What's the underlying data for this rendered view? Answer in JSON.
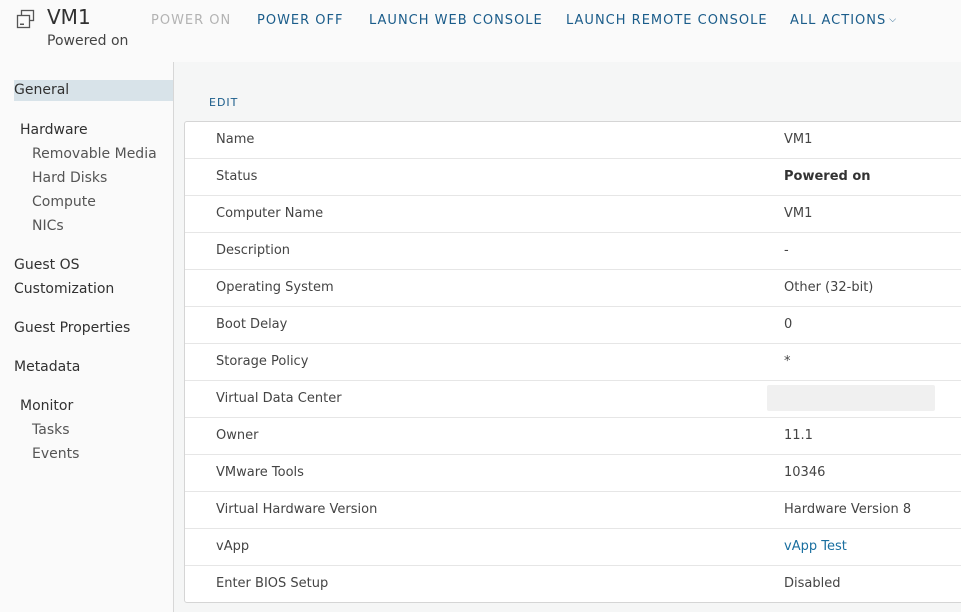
{
  "header": {
    "vm_name": "VM1",
    "vm_status": "Powered on",
    "icon": "vm-icon"
  },
  "actions": {
    "power_on": "POWER ON",
    "power_off": "POWER OFF",
    "launch_web_console": "LAUNCH WEB CONSOLE",
    "launch_remote_console": "LAUNCH REMOTE CONSOLE",
    "all_actions": "ALL ACTIONS"
  },
  "sidebar": {
    "general": "General",
    "hardware": "Hardware",
    "removable_media": "Removable Media",
    "hard_disks": "Hard Disks",
    "compute": "Compute",
    "nics": "NICs",
    "guest_os_customization": "Guest OS Customization",
    "guest_properties": "Guest Properties",
    "metadata": "Metadata",
    "monitor": "Monitor",
    "tasks": "Tasks",
    "events": "Events"
  },
  "main": {
    "edit_label": "EDIT",
    "rows": [
      {
        "label": "Name",
        "value": "VM1"
      },
      {
        "label": "Status",
        "value": "Powered on"
      },
      {
        "label": "Computer Name",
        "value": "VM1"
      },
      {
        "label": "Description",
        "value": "-"
      },
      {
        "label": "Operating System",
        "value": "Other (32-bit)"
      },
      {
        "label": "Boot Delay",
        "value": "0"
      },
      {
        "label": "Storage Policy",
        "value": "*"
      },
      {
        "label": "Virtual Data Center",
        "value": ""
      },
      {
        "label": "Owner",
        "value": "11.1"
      },
      {
        "label": "VMware Tools",
        "value": "10346"
      },
      {
        "label": "Virtual Hardware Version",
        "value": "Hardware Version 8"
      },
      {
        "label": "vApp",
        "value": "vApp Test"
      },
      {
        "label": "Enter BIOS Setup",
        "value": "Disabled"
      }
    ]
  },
  "colors": {
    "link": "#1a5c8a",
    "disabled": "#b3b3b3",
    "active_nav": "#d8e3e9"
  }
}
